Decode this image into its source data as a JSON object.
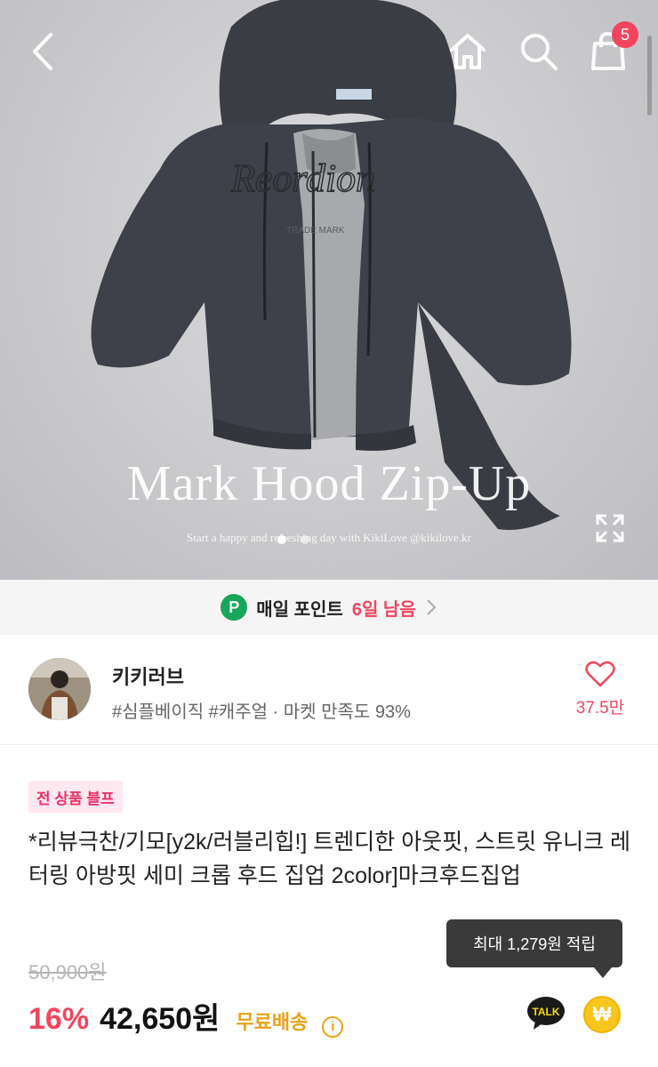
{
  "hero": {
    "title": "Mark Hood Zip-Up",
    "subtitle": "Start a happy and refreshing day with KikiLove @kikilove.kr",
    "cart_count": "5",
    "slide_count": 2,
    "active_slide": 1
  },
  "points": {
    "badge": "P",
    "label": "매일 포인트",
    "days_left": "6일 남음"
  },
  "shop": {
    "name": "키키러브",
    "tags": "#심플베이직 #캐주얼 · 마켓 만족도 93%",
    "favorite_count": "37.5만"
  },
  "product": {
    "badge": "전 상품 블프",
    "title": "*리뷰극찬/기모[y2k/러블리힙!] 트렌디한 아웃핏, 스트릿 유니크 레터링 아방핏 세미 크롭 후드 집업 2color]마크후드집업",
    "original_price": "50,900원",
    "discount": "16%",
    "price": "42,650원",
    "shipping": "무료배송",
    "info_icon": "i"
  },
  "tooltip": {
    "text": "최대 1,279원 적립"
  },
  "actions": {
    "talk_label": "TALK",
    "won_symbol": "₩"
  },
  "colors": {
    "accent": "#f2455d",
    "points_green": "#19a55c",
    "shipping": "#e5a31a"
  }
}
